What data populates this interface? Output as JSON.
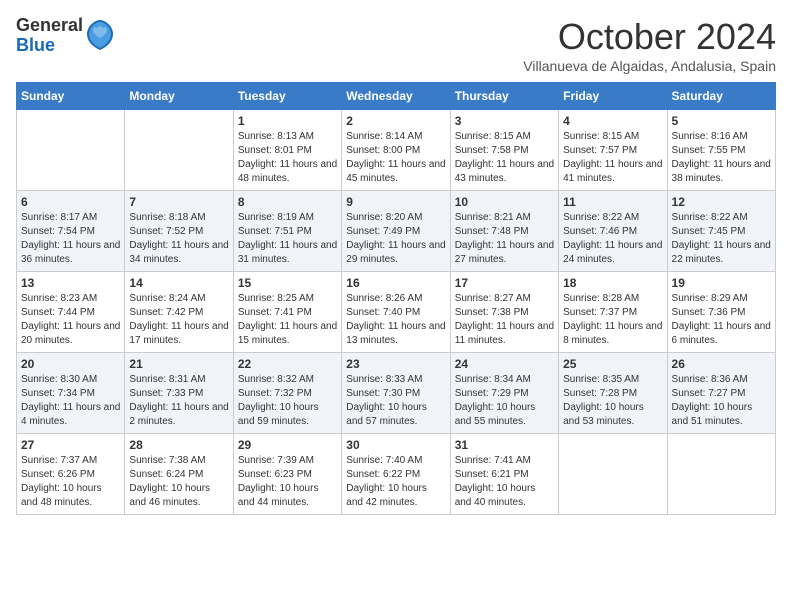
{
  "header": {
    "logo_general": "General",
    "logo_blue": "Blue",
    "month_title": "October 2024",
    "location": "Villanueva de Algaidas, Andalusia, Spain"
  },
  "days_of_week": [
    "Sunday",
    "Monday",
    "Tuesday",
    "Wednesday",
    "Thursday",
    "Friday",
    "Saturday"
  ],
  "weeks": [
    [
      {
        "day": "",
        "sunrise": "",
        "sunset": "",
        "daylight": ""
      },
      {
        "day": "",
        "sunrise": "",
        "sunset": "",
        "daylight": ""
      },
      {
        "day": "1",
        "sunrise": "Sunrise: 8:13 AM",
        "sunset": "Sunset: 8:01 PM",
        "daylight": "Daylight: 11 hours and 48 minutes."
      },
      {
        "day": "2",
        "sunrise": "Sunrise: 8:14 AM",
        "sunset": "Sunset: 8:00 PM",
        "daylight": "Daylight: 11 hours and 45 minutes."
      },
      {
        "day": "3",
        "sunrise": "Sunrise: 8:15 AM",
        "sunset": "Sunset: 7:58 PM",
        "daylight": "Daylight: 11 hours and 43 minutes."
      },
      {
        "day": "4",
        "sunrise": "Sunrise: 8:15 AM",
        "sunset": "Sunset: 7:57 PM",
        "daylight": "Daylight: 11 hours and 41 minutes."
      },
      {
        "day": "5",
        "sunrise": "Sunrise: 8:16 AM",
        "sunset": "Sunset: 7:55 PM",
        "daylight": "Daylight: 11 hours and 38 minutes."
      }
    ],
    [
      {
        "day": "6",
        "sunrise": "Sunrise: 8:17 AM",
        "sunset": "Sunset: 7:54 PM",
        "daylight": "Daylight: 11 hours and 36 minutes."
      },
      {
        "day": "7",
        "sunrise": "Sunrise: 8:18 AM",
        "sunset": "Sunset: 7:52 PM",
        "daylight": "Daylight: 11 hours and 34 minutes."
      },
      {
        "day": "8",
        "sunrise": "Sunrise: 8:19 AM",
        "sunset": "Sunset: 7:51 PM",
        "daylight": "Daylight: 11 hours and 31 minutes."
      },
      {
        "day": "9",
        "sunrise": "Sunrise: 8:20 AM",
        "sunset": "Sunset: 7:49 PM",
        "daylight": "Daylight: 11 hours and 29 minutes."
      },
      {
        "day": "10",
        "sunrise": "Sunrise: 8:21 AM",
        "sunset": "Sunset: 7:48 PM",
        "daylight": "Daylight: 11 hours and 27 minutes."
      },
      {
        "day": "11",
        "sunrise": "Sunrise: 8:22 AM",
        "sunset": "Sunset: 7:46 PM",
        "daylight": "Daylight: 11 hours and 24 minutes."
      },
      {
        "day": "12",
        "sunrise": "Sunrise: 8:22 AM",
        "sunset": "Sunset: 7:45 PM",
        "daylight": "Daylight: 11 hours and 22 minutes."
      }
    ],
    [
      {
        "day": "13",
        "sunrise": "Sunrise: 8:23 AM",
        "sunset": "Sunset: 7:44 PM",
        "daylight": "Daylight: 11 hours and 20 minutes."
      },
      {
        "day": "14",
        "sunrise": "Sunrise: 8:24 AM",
        "sunset": "Sunset: 7:42 PM",
        "daylight": "Daylight: 11 hours and 17 minutes."
      },
      {
        "day": "15",
        "sunrise": "Sunrise: 8:25 AM",
        "sunset": "Sunset: 7:41 PM",
        "daylight": "Daylight: 11 hours and 15 minutes."
      },
      {
        "day": "16",
        "sunrise": "Sunrise: 8:26 AM",
        "sunset": "Sunset: 7:40 PM",
        "daylight": "Daylight: 11 hours and 13 minutes."
      },
      {
        "day": "17",
        "sunrise": "Sunrise: 8:27 AM",
        "sunset": "Sunset: 7:38 PM",
        "daylight": "Daylight: 11 hours and 11 minutes."
      },
      {
        "day": "18",
        "sunrise": "Sunrise: 8:28 AM",
        "sunset": "Sunset: 7:37 PM",
        "daylight": "Daylight: 11 hours and 8 minutes."
      },
      {
        "day": "19",
        "sunrise": "Sunrise: 8:29 AM",
        "sunset": "Sunset: 7:36 PM",
        "daylight": "Daylight: 11 hours and 6 minutes."
      }
    ],
    [
      {
        "day": "20",
        "sunrise": "Sunrise: 8:30 AM",
        "sunset": "Sunset: 7:34 PM",
        "daylight": "Daylight: 11 hours and 4 minutes."
      },
      {
        "day": "21",
        "sunrise": "Sunrise: 8:31 AM",
        "sunset": "Sunset: 7:33 PM",
        "daylight": "Daylight: 11 hours and 2 minutes."
      },
      {
        "day": "22",
        "sunrise": "Sunrise: 8:32 AM",
        "sunset": "Sunset: 7:32 PM",
        "daylight": "Daylight: 10 hours and 59 minutes."
      },
      {
        "day": "23",
        "sunrise": "Sunrise: 8:33 AM",
        "sunset": "Sunset: 7:30 PM",
        "daylight": "Daylight: 10 hours and 57 minutes."
      },
      {
        "day": "24",
        "sunrise": "Sunrise: 8:34 AM",
        "sunset": "Sunset: 7:29 PM",
        "daylight": "Daylight: 10 hours and 55 minutes."
      },
      {
        "day": "25",
        "sunrise": "Sunrise: 8:35 AM",
        "sunset": "Sunset: 7:28 PM",
        "daylight": "Daylight: 10 hours and 53 minutes."
      },
      {
        "day": "26",
        "sunrise": "Sunrise: 8:36 AM",
        "sunset": "Sunset: 7:27 PM",
        "daylight": "Daylight: 10 hours and 51 minutes."
      }
    ],
    [
      {
        "day": "27",
        "sunrise": "Sunrise: 7:37 AM",
        "sunset": "Sunset: 6:26 PM",
        "daylight": "Daylight: 10 hours and 48 minutes."
      },
      {
        "day": "28",
        "sunrise": "Sunrise: 7:38 AM",
        "sunset": "Sunset: 6:24 PM",
        "daylight": "Daylight: 10 hours and 46 minutes."
      },
      {
        "day": "29",
        "sunrise": "Sunrise: 7:39 AM",
        "sunset": "Sunset: 6:23 PM",
        "daylight": "Daylight: 10 hours and 44 minutes."
      },
      {
        "day": "30",
        "sunrise": "Sunrise: 7:40 AM",
        "sunset": "Sunset: 6:22 PM",
        "daylight": "Daylight: 10 hours and 42 minutes."
      },
      {
        "day": "31",
        "sunrise": "Sunrise: 7:41 AM",
        "sunset": "Sunset: 6:21 PM",
        "daylight": "Daylight: 10 hours and 40 minutes."
      },
      {
        "day": "",
        "sunrise": "",
        "sunset": "",
        "daylight": ""
      },
      {
        "day": "",
        "sunrise": "",
        "sunset": "",
        "daylight": ""
      }
    ]
  ]
}
